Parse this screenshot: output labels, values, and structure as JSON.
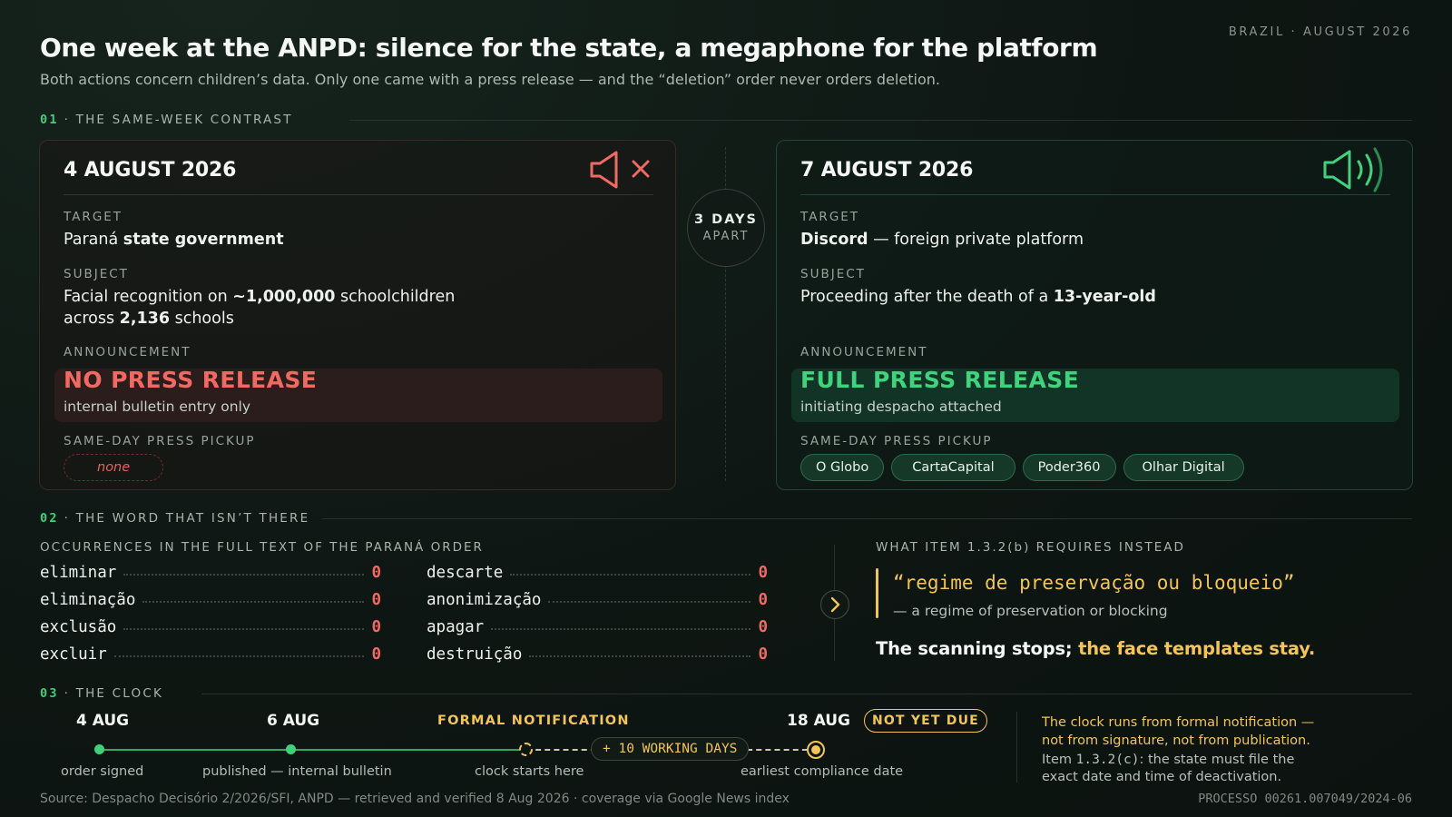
{
  "header": {
    "title": "One week at the ANPD: silence for the state, a megaphone for the platform",
    "subtitle": "Both actions concern children’s data. Only one came with a press release — and the “deletion” order never orders deletion.",
    "dateline": "BRAZIL · AUGUST 2026"
  },
  "section1": {
    "num": "01",
    "title": "· THE SAME-WEEK CONTRAST"
  },
  "left_card": {
    "date": "4 AUGUST 2026",
    "icon": "speaker-muted-icon",
    "target_label": "TARGET",
    "target_a": "Paraná ",
    "target_b": "state government",
    "subject_label": "SUBJECT",
    "subject_1": "Facial recognition on ",
    "subject_2": "~1,000,000",
    "subject_3": " schoolchildren",
    "subject_4": "across ",
    "subject_5": "2,136",
    "subject_6": " schools",
    "announcement_label": "ANNOUNCEMENT",
    "announcement": "NO PRESS RELEASE",
    "announcement_note": "internal bulletin entry only",
    "pickup_label": "SAME-DAY PRESS PICKUP",
    "pickup_none": "none",
    "accent": "#f06a63"
  },
  "gap_badge": {
    "line1": "3 DAYS",
    "line2": "APART"
  },
  "right_card": {
    "date": "7 AUGUST 2026",
    "icon": "speaker-loud-icon",
    "target_label": "TARGET",
    "target_a": "Discord",
    "target_b": " — foreign private platform",
    "subject_label": "SUBJECT",
    "subject_1": "Proceeding after the death of a ",
    "subject_2": "13-year-old",
    "announcement_label": "ANNOUNCEMENT",
    "announcement": "FULL PRESS RELEASE",
    "announcement_note": "initiating despacho attached",
    "pickup_label": "SAME-DAY PRESS PICKUP",
    "outlets": [
      "O Globo",
      "CartaCapital",
      "Poder360",
      "Olhar Digital"
    ],
    "accent": "#41d27d"
  },
  "section2": {
    "num": "02",
    "title": "· THE WORD THAT ISN’T THERE"
  },
  "occurrences": {
    "label": "OCCURRENCES IN THE FULL TEXT OF THE PARANÁ ORDER",
    "col1": [
      {
        "word": "eliminar",
        "count": "0"
      },
      {
        "word": "eliminação",
        "count": "0"
      },
      {
        "word": "exclusão",
        "count": "0"
      },
      {
        "word": "excluir",
        "count": "0"
      }
    ],
    "col2": [
      {
        "word": "descarte",
        "count": "0"
      },
      {
        "word": "anonimização",
        "count": "0"
      },
      {
        "word": "apagar",
        "count": "0"
      },
      {
        "word": "destruição",
        "count": "0"
      }
    ]
  },
  "requires": {
    "label": "WHAT ITEM 1.3.2(b) REQUIRES INSTEAD",
    "quote": "“regime de preservação ou bloqueio”",
    "translation": "— a regime of preservation or blocking",
    "conclusion_a": "The scanning stops; ",
    "conclusion_b": "the face templates stay."
  },
  "section3": {
    "num": "03",
    "title": "· THE CLOCK"
  },
  "timeline": {
    "p1_label": "4 AUG",
    "p1_sub": "order signed",
    "p2_label": "6 AUG",
    "p2_sub": "published — internal bulletin",
    "p3_label": "FORMAL NOTIFICATION",
    "p3_sub": "clock starts here",
    "working_days": "+ 10 WORKING DAYS",
    "p4_label": "18 AUG",
    "p4_badge": "NOT YET DUE",
    "p4_sub": "earliest compliance date"
  },
  "clock_note": {
    "line1": "The clock runs from formal notification —",
    "line2": "not from signature, not from publication.",
    "line3a": "Item ",
    "line3code": "1.3.2(c)",
    "line3b": ": the state must file the",
    "line4": "exact date and time of deactivation."
  },
  "footer": {
    "source": "Source: Despacho Decisório 2/2026/SFI, ANPD — retrieved and verified 8 Aug 2026 · coverage via Google News index",
    "process": "PROCESSO 00261.007049/2024-06"
  }
}
